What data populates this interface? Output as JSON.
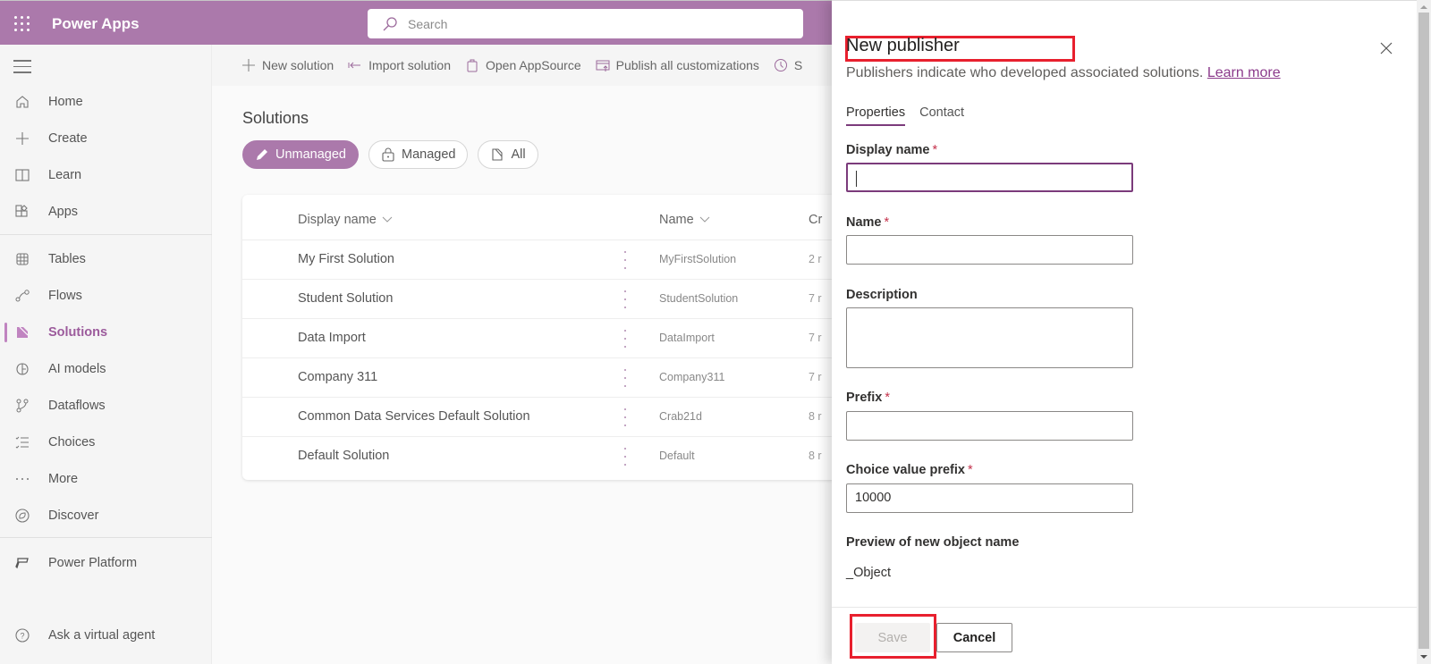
{
  "topbar": {
    "app_title": "Power Apps",
    "search_placeholder": "Search"
  },
  "sidebar": {
    "items": [
      {
        "label": "Home",
        "icon": "home-icon"
      },
      {
        "label": "Create",
        "icon": "plus-icon"
      },
      {
        "label": "Learn",
        "icon": "book-icon"
      },
      {
        "label": "Apps",
        "icon": "apps-icon"
      },
      {
        "label": "Tables",
        "icon": "table-icon"
      },
      {
        "label": "Flows",
        "icon": "flow-icon"
      },
      {
        "label": "Solutions",
        "icon": "solutions-icon",
        "active": true
      },
      {
        "label": "AI models",
        "icon": "ai-models-icon"
      },
      {
        "label": "Dataflows",
        "icon": "dataflows-icon"
      },
      {
        "label": "Choices",
        "icon": "choices-icon"
      },
      {
        "label": "More",
        "icon": "more-icon"
      },
      {
        "label": "Discover",
        "icon": "discover-icon"
      },
      {
        "label": "Power Platform",
        "icon": "power-platform-icon"
      },
      {
        "label": "Ask a virtual agent",
        "icon": "help-chat-icon"
      }
    ]
  },
  "commandbar": {
    "new_solution": "New solution",
    "import_solution": "Import solution",
    "open_appsource": "Open AppSource",
    "publish_all": "Publish all customizations",
    "truncated_item": "S"
  },
  "main": {
    "title": "Solutions",
    "filters": [
      {
        "label": "Unmanaged",
        "active": true
      },
      {
        "label": "Managed",
        "active": false
      },
      {
        "label": "All",
        "active": false
      }
    ],
    "table": {
      "columns": [
        "Display name",
        "Name",
        "Cr"
      ],
      "rows": [
        {
          "display_name": "My First Solution",
          "name": "MyFirstSolution",
          "created": "2 r"
        },
        {
          "display_name": "Student Solution",
          "name": "StudentSolution",
          "created": "7 r"
        },
        {
          "display_name": "Data Import",
          "name": "DataImport",
          "created": "7 r"
        },
        {
          "display_name": "Company 311",
          "name": "Company311",
          "created": "7 r"
        },
        {
          "display_name": "Common Data Services Default Solution",
          "name": "Crab21d",
          "created": "8 r"
        },
        {
          "display_name": "Default Solution",
          "name": "Default",
          "created": "8 r"
        }
      ]
    }
  },
  "panel": {
    "title": "New publisher",
    "subtitle": "Publishers indicate who developed associated solutions.",
    "learn_more": "Learn more",
    "tabs": [
      {
        "label": "Properties",
        "active": true
      },
      {
        "label": "Contact",
        "active": false
      }
    ],
    "fields": {
      "display_name": {
        "label": "Display name",
        "required": "*",
        "value": ""
      },
      "name": {
        "label": "Name",
        "required": "*",
        "value": ""
      },
      "description": {
        "label": "Description",
        "value": ""
      },
      "prefix": {
        "label": "Prefix",
        "required": "*",
        "value": ""
      },
      "choice_value_prefix": {
        "label": "Choice value prefix",
        "required": "*",
        "value": "10000"
      }
    },
    "preview_label": "Preview of new object name",
    "preview_value": "_Object",
    "save_label": "Save",
    "cancel_label": "Cancel"
  },
  "colors": {
    "brand": "#ab79ab",
    "accent_dark": "#7b3b7b",
    "highlight_box": "#e8202e",
    "required": "#c4314b"
  }
}
